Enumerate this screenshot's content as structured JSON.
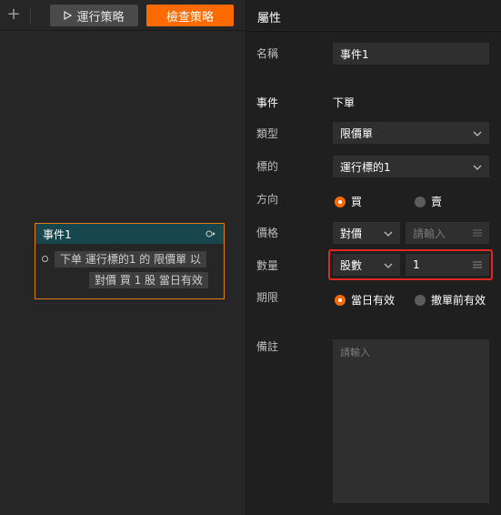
{
  "toolbar": {
    "add_icon": "plus-icon",
    "run_label": "運行策略",
    "check_label": "檢查策略",
    "check_color": "#ff6a00"
  },
  "node": {
    "title": "事件1",
    "line1": "下单 運行標的1 的 限價單 以",
    "line2": "對價  買 1 股 當日有效"
  },
  "panel": {
    "title": "屬性",
    "name_label": "名稱",
    "name_value": "事件1",
    "event_label": "事件",
    "event_value": "下單",
    "type_label": "類型",
    "type_value": "限價單",
    "target_label": "標的",
    "target_value": "運行標的1",
    "direction_label": "方向",
    "direction_options": [
      "買",
      "賣"
    ],
    "direction_selected": "買",
    "price_label": "價格",
    "price_mode": "對價",
    "price_placeholder": "請輸入",
    "qty_label": "數量",
    "qty_unit": "股數",
    "qty_value": "1",
    "expiry_label": "期限",
    "expiry_options": [
      "當日有效",
      "撤單前有效"
    ],
    "expiry_selected": "當日有效",
    "remark_label": "備註",
    "remark_placeholder": "請輸入"
  }
}
